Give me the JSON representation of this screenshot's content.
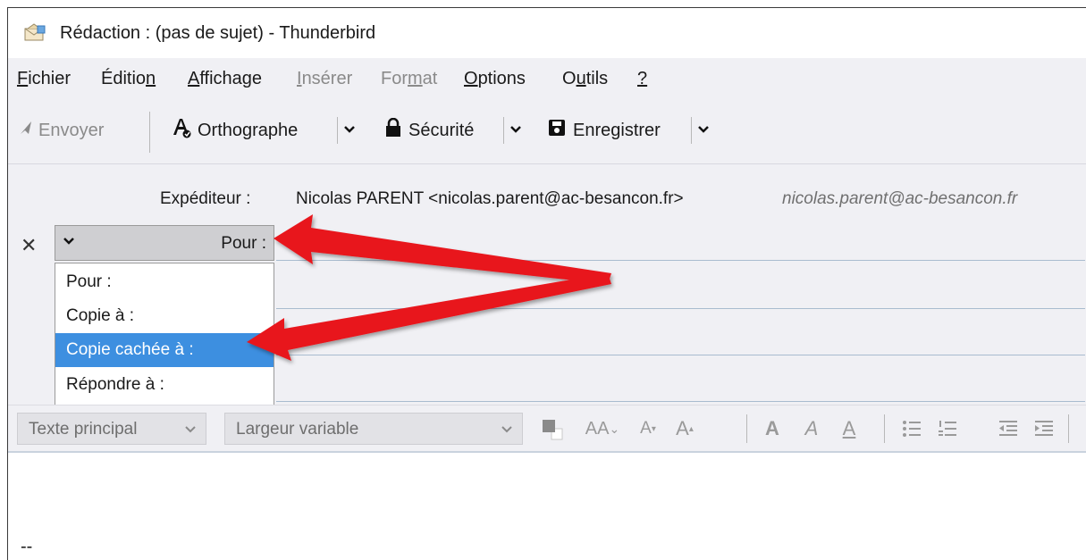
{
  "window": {
    "title": "Rédaction : (pas de sujet) - Thunderbird"
  },
  "menubar": {
    "items": [
      {
        "label": "Fichier",
        "disabled": false
      },
      {
        "label": "Édition",
        "disabled": false
      },
      {
        "label": "Affichage",
        "disabled": false
      },
      {
        "label": "Insérer",
        "disabled": true
      },
      {
        "label": "Format",
        "disabled": true
      },
      {
        "label": "Options",
        "disabled": false
      },
      {
        "label": "Outils",
        "disabled": false
      },
      {
        "label": "?",
        "disabled": false
      }
    ]
  },
  "toolbar": {
    "send_label": "Envoyer",
    "spelling_label": "Orthographe",
    "security_label": "Sécurité",
    "save_label": "Enregistrer"
  },
  "headers": {
    "sender_label": "Expéditeur :",
    "sender_value": "Nicolas PARENT <nicolas.parent@ac-besancon.fr>",
    "sender_alt": "nicolas.parent@ac-besancon.fr",
    "remove_glyph": "✕",
    "recipient_type_selected": "Pour :",
    "recipient_type_options": [
      "Pour :",
      "Copie à :",
      "Copie cachée à :",
      "Répondre à :"
    ],
    "highlighted_option": "Copie cachée à :"
  },
  "format_toolbar": {
    "paragraph_style": "Texte principal",
    "font_family": "Largeur variable",
    "icons": [
      "text-color-icon",
      "font-size-icon",
      "smaller-text-icon",
      "larger-text-icon",
      "bold-icon",
      "italic-icon",
      "underline-icon",
      "bullet-list-icon",
      "numbered-list-icon",
      "outdent-icon",
      "indent-icon"
    ]
  },
  "body": {
    "signature_separator": "--"
  },
  "colors": {
    "accent": "#3d8fe0",
    "annotation_arrow": "#e8141b"
  }
}
